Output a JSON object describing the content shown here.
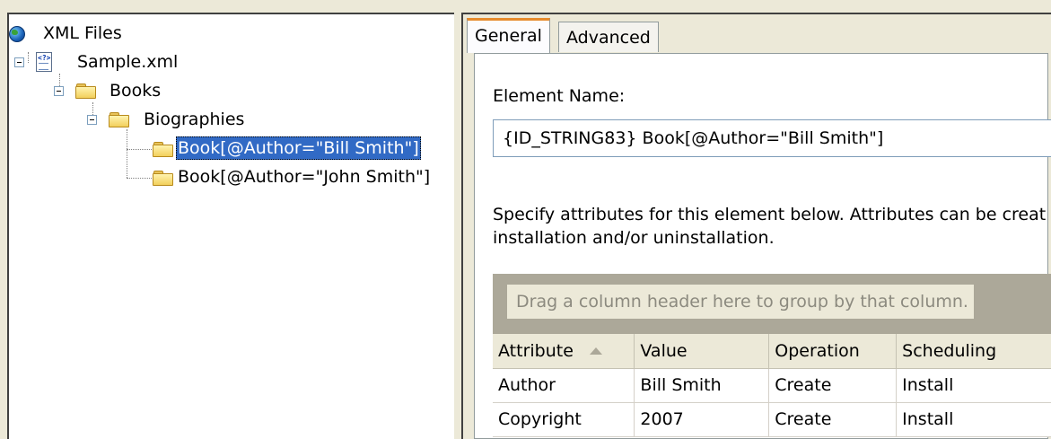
{
  "tree": {
    "root": {
      "label": "XML Files",
      "icon": "globe-icon"
    },
    "file": {
      "label": "Sample.xml",
      "icon": "xml-file-icon"
    },
    "books": {
      "label": "Books",
      "icon": "folder-icon"
    },
    "biographies": {
      "label": "Biographies",
      "icon": "folder-icon"
    },
    "items": [
      {
        "label": "Book[@Author=\"Bill Smith\"]",
        "icon": "folder-icon",
        "selected": true
      },
      {
        "label": "Book[@Author=\"John Smith\"]",
        "icon": "folder-icon",
        "selected": false
      }
    ]
  },
  "tabs": [
    {
      "label": "General",
      "active": true
    },
    {
      "label": "Advanced",
      "active": false
    }
  ],
  "general": {
    "element_name_label": "Element Name:",
    "element_name_value": "{ID_STRING83} Book[@Author=\"Bill Smith\"]",
    "description_line1": "Specify attributes for this element below. Attributes can be creat",
    "description_line2": "installation and/or uninstallation."
  },
  "grid": {
    "group_hint": "Drag a column header here to group by that column.",
    "columns": [
      "Attribute",
      "Value",
      "Operation",
      "Scheduling"
    ],
    "sorted_column": "Attribute",
    "rows": [
      [
        "Author",
        "Bill Smith",
        "Create",
        "Install"
      ],
      [
        "Copyright",
        "2007",
        "Create",
        "Install"
      ]
    ]
  },
  "colors": {
    "selection": "#316ac5",
    "tab_highlight": "#e68b2c",
    "window_bg": "#ece9d8"
  }
}
